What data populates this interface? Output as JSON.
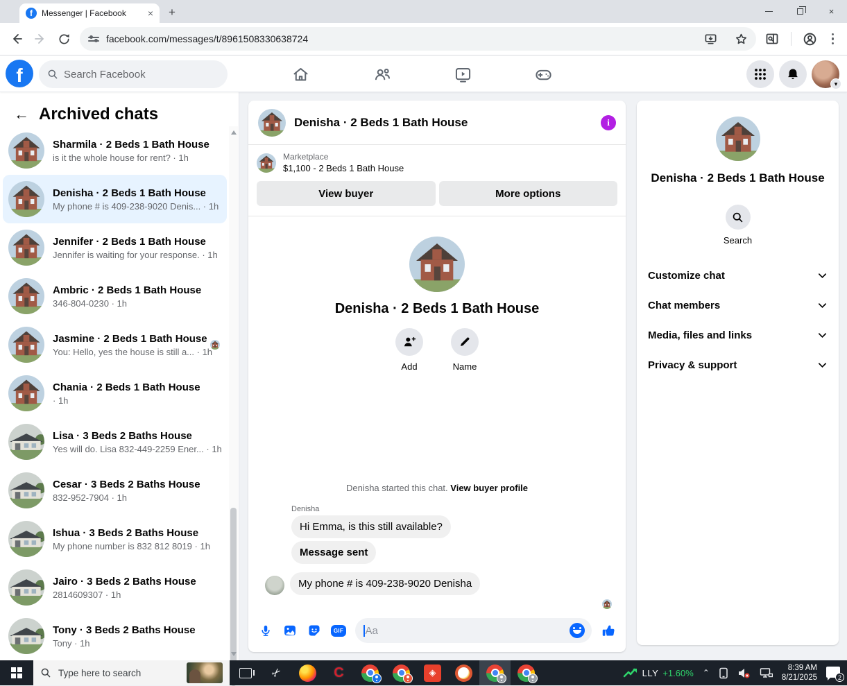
{
  "browser": {
    "tab_title": "Messenger | Facebook",
    "url": "facebook.com/messages/t/8961508330638724"
  },
  "fb_header": {
    "search_placeholder": "Search Facebook"
  },
  "sidebar": {
    "title": "Archived chats",
    "chats": [
      {
        "name": "Sharmila · 2 Beds 1 Bath House",
        "subtitle": "is it the whole house for rent? · 1h",
        "house": "colonial",
        "selected": false
      },
      {
        "name": "Denisha · 2 Beds 1 Bath House",
        "subtitle": "My phone # is 409-238-9020 Denis... · 1h",
        "house": "colonial",
        "selected": true
      },
      {
        "name": "Jennifer · 2 Beds 1 Bath House",
        "subtitle": "Jennifer is waiting for your response. · 1h",
        "house": "colonial",
        "selected": false
      },
      {
        "name": "Ambric · 2 Beds 1 Bath House",
        "subtitle": "346-804-0230 · 1h",
        "house": "colonial",
        "selected": false
      },
      {
        "name": "Jasmine · 2 Beds 1 Bath House",
        "subtitle": "You: Hello, yes the house is still a... · 1h",
        "house": "colonial",
        "selected": false,
        "receipt": true
      },
      {
        "name": "Chania · 2 Beds 1 Bath House",
        "subtitle": "· 1h",
        "house": "colonial",
        "selected": false
      },
      {
        "name": "Lisa · 3 Beds 2 Baths House",
        "subtitle": "Yes will do. Lisa 832-449-2259 Ener... · 1h",
        "house": "ranch",
        "selected": false
      },
      {
        "name": "Cesar · 3 Beds 2 Baths House",
        "subtitle": "832-952-7904 · 1h",
        "house": "ranch",
        "selected": false
      },
      {
        "name": "Ishua · 3 Beds 2 Baths House",
        "subtitle": "My phone number is 832 812 8019 · 1h",
        "house": "ranch",
        "selected": false
      },
      {
        "name": "Jairo · 3 Beds 2 Baths House",
        "subtitle": "2814609307 · 1h",
        "house": "ranch",
        "selected": false
      },
      {
        "name": "Tony · 3 Beds 2 Baths House",
        "subtitle": "Tony · 1h",
        "house": "ranch",
        "selected": false
      }
    ]
  },
  "chat": {
    "title": "Denisha · 2 Beds 1 Bath House",
    "marketplace": {
      "label": "Marketplace",
      "listing": "$1,100 - 2 Beds 1 Bath House",
      "view_buyer": "View buyer",
      "more_options": "More options"
    },
    "intro": {
      "title": "Denisha · 2 Beds 1 Bath House",
      "add_label": "Add",
      "name_label": "Name"
    },
    "system_prefix": "Denisha started this chat. ",
    "system_link": "View buyer profile",
    "sender": "Denisha",
    "messages": [
      "Hi Emma, is this still available?",
      "Message sent",
      "My phone # is 409-238-9020  Denisha"
    ],
    "composer_placeholder": "Aa"
  },
  "right_panel": {
    "title": "Denisha · 2 Beds 1 Bath House",
    "search_label": "Search",
    "sections": [
      {
        "label": "Customize chat"
      },
      {
        "label": "Chat members"
      },
      {
        "label": "Media, files and links"
      },
      {
        "label": "Privacy & support"
      }
    ]
  },
  "taskbar": {
    "search_placeholder": "Type here to search",
    "stock_ticker": "LLY",
    "stock_change": "+1.60%",
    "time": "8:39 AM",
    "date": "8/21/2025",
    "notification_count": "2"
  },
  "colors": {
    "accent_blue": "#0866ff",
    "facebook_blue": "#1877f2",
    "info_purple": "#b21fe3",
    "selected_chat_bg": "#e7f3ff",
    "stock_green": "#2fd36b"
  }
}
